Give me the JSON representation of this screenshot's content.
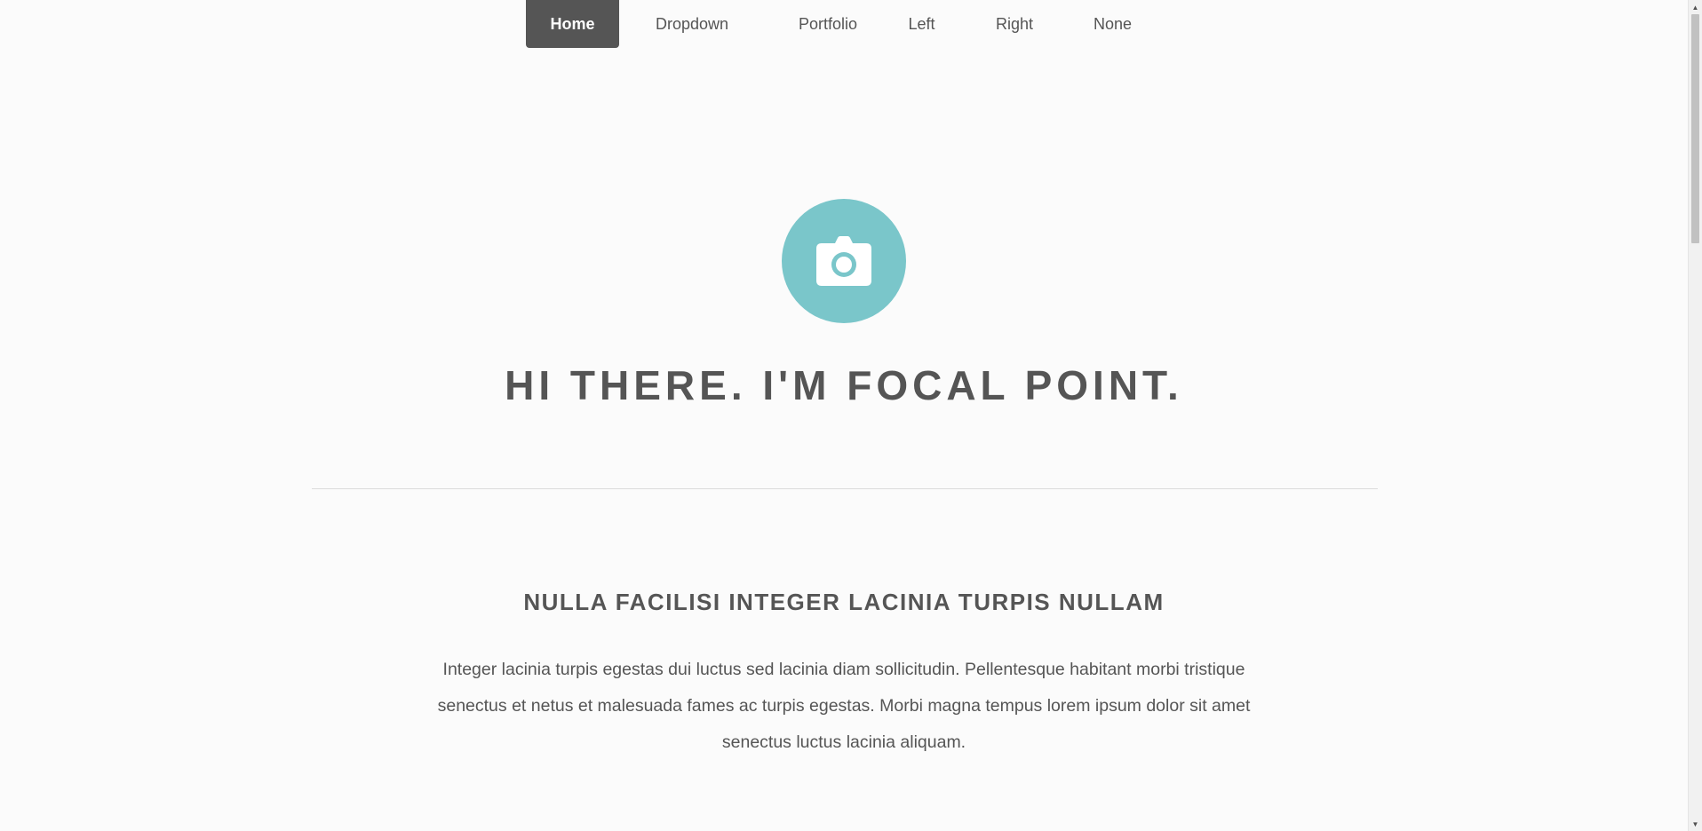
{
  "nav": {
    "items": [
      {
        "label": "Home",
        "active": true
      },
      {
        "label": "Dropdown"
      },
      {
        "label": "Portfolio"
      },
      {
        "label": "Left"
      },
      {
        "label": "Right"
      },
      {
        "label": "None"
      }
    ]
  },
  "hero": {
    "icon": "camera-icon",
    "icon_color": "#7ac6ca",
    "title": "HI THERE. I'M FOCAL POINT."
  },
  "section": {
    "title": "NULLA FACILISI INTEGER LACINIA TURPIS NULLAM",
    "text": "Integer lacinia turpis egestas dui luctus sed lacinia diam sollicitudin. Pellentesque habitant morbi tristique senectus et netus et malesuada fames ac turpis egestas. Morbi magna tempus lorem ipsum dolor sit amet senectus luctus lacinia aliquam."
  },
  "colors": {
    "accent": "#7ac6ca",
    "nav_active_bg": "#555555",
    "text": "#555555",
    "background": "#fbfbfb"
  },
  "scrollbar": {
    "up_icon": "scroll-up-arrow-icon",
    "down_icon": "scroll-down-arrow-icon"
  }
}
